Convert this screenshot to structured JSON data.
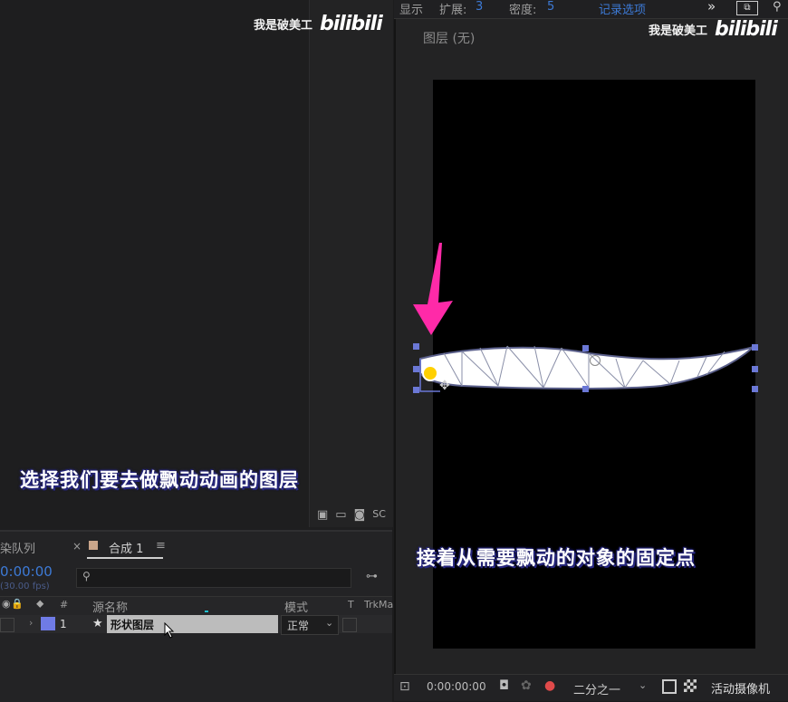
{
  "watermark": {
    "text": "我是破美工",
    "logo": "bilibili"
  },
  "left": {
    "subtitle": "选择我们要去做飘动动画的图层",
    "timeline": {
      "tab_render_queue": "染队列",
      "tab_close": "×",
      "tab_comp": "合成 1",
      "tab_menu": "≡",
      "timecode": "0:00:00",
      "timecode_fps": "(30.00 fps)",
      "col_hash": "#",
      "col_source_name": "源名称",
      "col_mode": "模式",
      "col_t": "T",
      "col_trkmat": "TrkMa",
      "layer": {
        "index": "1",
        "name": "形状图层",
        "mode": "正常"
      }
    }
  },
  "right": {
    "toolbar": {
      "display": "显示",
      "expand_label": "扩展:",
      "expand_value": "3",
      "density_label": "密度:",
      "density_value": "5",
      "record_options": "记录选项",
      "more": "»"
    },
    "layer_title": "图层 (无)",
    "subtitle": "接着从需要飘动的对象的固定点",
    "bottom": {
      "timecode": "0:00:00:00",
      "resolution": "二分之一",
      "camera": "活动摄像机"
    }
  },
  "colors": {
    "accent": "#ff2aa8",
    "handle": "#6b78d6",
    "pin": "#ffd000",
    "label": "#6f7be6"
  }
}
